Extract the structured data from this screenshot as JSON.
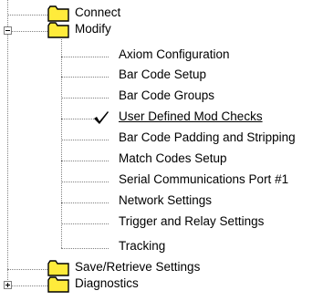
{
  "tree": {
    "items": [
      {
        "label": "Connect",
        "kind": "folder",
        "expander": "none"
      },
      {
        "label": "Modify",
        "kind": "folder",
        "expander": "minus"
      },
      {
        "label": "Axiom Configuration",
        "kind": "leaf"
      },
      {
        "label": "Bar Code Setup",
        "kind": "leaf"
      },
      {
        "label": "Bar Code Groups",
        "kind": "leaf"
      },
      {
        "label": "User Defined Mod Checks",
        "kind": "leaf",
        "active": true,
        "icon": "checkmark-icon"
      },
      {
        "label": "Bar Code Padding and Stripping",
        "kind": "leaf"
      },
      {
        "label": "Match Codes Setup",
        "kind": "leaf"
      },
      {
        "label": "Serial Communications Port #1",
        "kind": "leaf"
      },
      {
        "label": "Network Settings",
        "kind": "leaf"
      },
      {
        "label": "Trigger and Relay Settings",
        "kind": "leaf"
      },
      {
        "label": "Tracking",
        "kind": "leaf"
      },
      {
        "label": "Save/Retrieve Settings",
        "kind": "folder",
        "expander": "none"
      },
      {
        "label": "Diagnostics",
        "kind": "folder",
        "expander": "plus"
      }
    ]
  },
  "colors": {
    "folder_fill": "#FFEB3B",
    "folder_outline": "#000000",
    "tree_line": "#808080",
    "text": "#000000"
  }
}
